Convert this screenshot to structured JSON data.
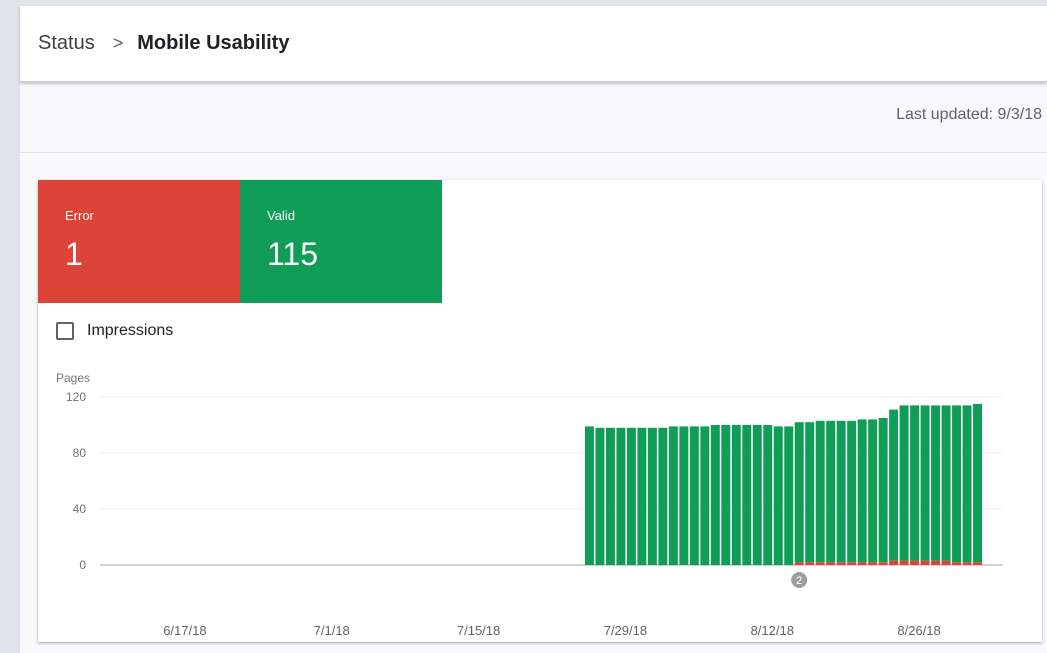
{
  "breadcrumb": {
    "parent": "Status",
    "separator": ">",
    "current": "Mobile Usability"
  },
  "last_updated": "Last updated: 9/3/18",
  "tiles": [
    {
      "label": "Error",
      "value": "1",
      "color": "#db4437"
    },
    {
      "label": "Valid",
      "value": "115",
      "color": "#0f9d58"
    }
  ],
  "impressions": {
    "label": "Impressions",
    "checked": false
  },
  "annotation": {
    "label": "2"
  },
  "colors": {
    "error": "#db4437",
    "valid": "#0f9d58"
  },
  "chart_data": {
    "type": "bar",
    "stacked": true,
    "ylabel": "Pages",
    "ylim": [
      0,
      120
    ],
    "yticks": [
      0,
      40,
      80,
      120
    ],
    "x_start": "2018-06-07",
    "x_end": "2018-09-03",
    "xtick_labels": [
      "6/17/18",
      "7/1/18",
      "7/15/18",
      "7/29/18",
      "8/12/18",
      "8/26/18"
    ],
    "series": [
      {
        "name": "Error",
        "color": "#db4437",
        "dates": [
          "2018-08-15",
          "2018-08-16",
          "2018-08-17",
          "2018-08-18",
          "2018-08-19",
          "2018-08-20",
          "2018-08-21",
          "2018-08-22",
          "2018-08-23",
          "2018-08-24",
          "2018-08-25",
          "2018-08-26",
          "2018-08-27",
          "2018-08-28",
          "2018-08-29",
          "2018-08-30",
          "2018-08-31",
          "2018-09-01"
        ],
        "values": [
          2,
          2,
          2,
          2,
          2,
          2,
          2,
          2,
          2,
          3,
          3,
          3,
          3,
          3,
          3,
          2,
          2,
          2
        ]
      },
      {
        "name": "Valid",
        "color": "#0f9d58",
        "dates": [
          "2018-07-26",
          "2018-07-27",
          "2018-07-28",
          "2018-07-29",
          "2018-07-30",
          "2018-07-31",
          "2018-08-01",
          "2018-08-02",
          "2018-08-03",
          "2018-08-04",
          "2018-08-05",
          "2018-08-06",
          "2018-08-07",
          "2018-08-08",
          "2018-08-09",
          "2018-08-10",
          "2018-08-11",
          "2018-08-12",
          "2018-08-13",
          "2018-08-14",
          "2018-08-15",
          "2018-08-16",
          "2018-08-17",
          "2018-08-18",
          "2018-08-19",
          "2018-08-20",
          "2018-08-21",
          "2018-08-22",
          "2018-08-23",
          "2018-08-24",
          "2018-08-25",
          "2018-08-26",
          "2018-08-27",
          "2018-08-28",
          "2018-08-29",
          "2018-08-30",
          "2018-08-31",
          "2018-09-01"
        ],
        "values": [
          99,
          98,
          98,
          98,
          98,
          98,
          98,
          98,
          99,
          99,
          99,
          99,
          100,
          100,
          100,
          100,
          100,
          100,
          99,
          99,
          100,
          100,
          101,
          101,
          101,
          101,
          102,
          102,
          103,
          108,
          111,
          111,
          111,
          111,
          111,
          112,
          112,
          113
        ]
      }
    ]
  }
}
